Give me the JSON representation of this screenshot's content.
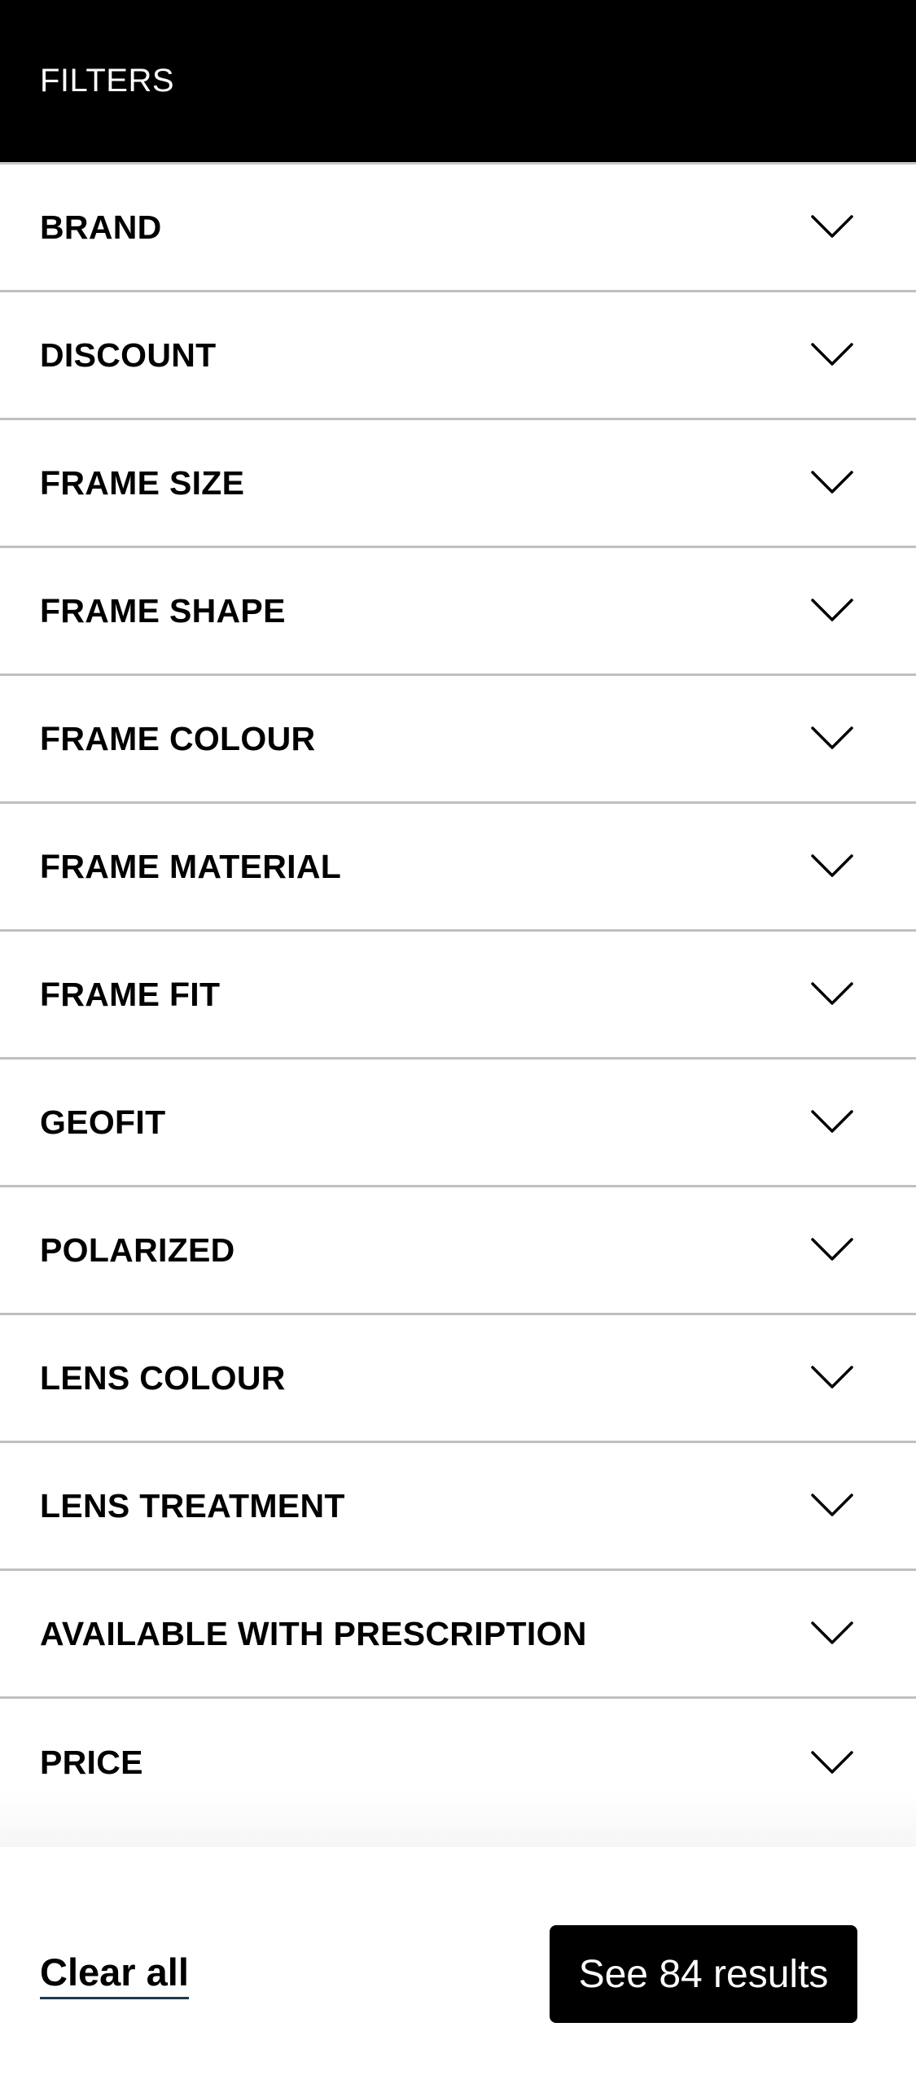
{
  "header": {
    "title": "FILTERS"
  },
  "filters": [
    {
      "label": "BRAND",
      "icon": "chevron-down-icon"
    },
    {
      "label": "DISCOUNT",
      "icon": "chevron-down-icon"
    },
    {
      "label": "FRAME SIZE",
      "icon": "chevron-down-icon"
    },
    {
      "label": "FRAME SHAPE",
      "icon": "chevron-down-icon"
    },
    {
      "label": "FRAME COLOUR",
      "icon": "chevron-down-icon"
    },
    {
      "label": "FRAME MATERIAL",
      "icon": "chevron-down-icon"
    },
    {
      "label": "FRAME FIT",
      "icon": "chevron-down-icon"
    },
    {
      "label": "GEOFIT",
      "icon": "chevron-down-icon"
    },
    {
      "label": "POLARIZED",
      "icon": "chevron-down-icon"
    },
    {
      "label": "LENS COLOUR",
      "icon": "chevron-down-icon"
    },
    {
      "label": "LENS TREATMENT",
      "icon": "chevron-down-icon"
    },
    {
      "label": "AVAILABLE WITH PRESCRIPTION",
      "icon": "chevron-down-icon"
    },
    {
      "label": "PRICE",
      "icon": "chevron-down-icon"
    }
  ],
  "footer": {
    "clear_all_label": "Clear all",
    "see_results_label": "See 84 results"
  },
  "colors": {
    "header_bg": "#000000",
    "header_text": "#ffffff",
    "divider": "#c0c0c0",
    "button_bg": "#000000",
    "link_underline": "#1f3a4d"
  }
}
